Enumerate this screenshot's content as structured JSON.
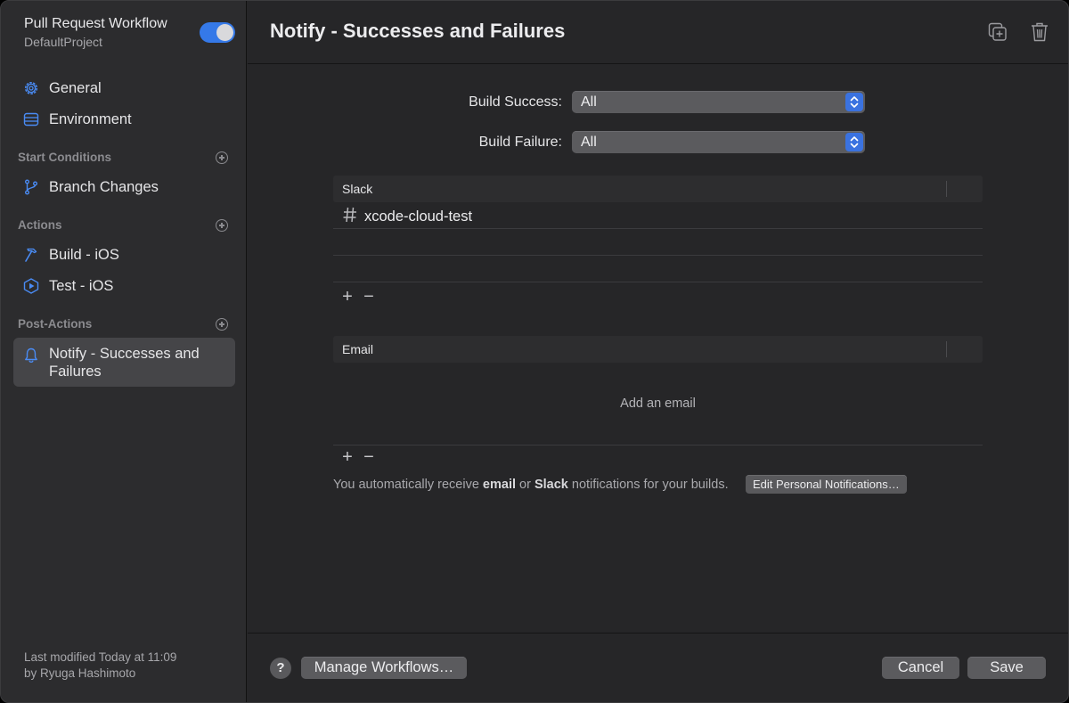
{
  "sidebar": {
    "workflow_title": "Pull Request Workflow",
    "project_name": "DefaultProject",
    "enabled": true,
    "general_label": "General",
    "environment_label": "Environment",
    "sections": {
      "start_conditions": "Start Conditions",
      "actions": "Actions",
      "post_actions": "Post-Actions"
    },
    "branch_changes_label": "Branch Changes",
    "build_label": "Build - iOS",
    "test_label": "Test - iOS",
    "notify_label_line1": "Notify - Successes and",
    "notify_label_line2": "Failures",
    "footer_line1": "Last modified Today at 11:09",
    "footer_line2": "by Ryuga Hashimoto"
  },
  "main": {
    "title": "Notify - Successes and Failures",
    "build_success_label": "Build Success:",
    "build_success_value": "All",
    "build_failure_label": "Build Failure:",
    "build_failure_value": "All",
    "slack": {
      "header": "Slack",
      "channels": [
        "xcode-cloud-test"
      ]
    },
    "email": {
      "header": "Email",
      "empty_text": "Add an email"
    },
    "plus": "+",
    "minus": "−",
    "note_prefix": "You automatically receive ",
    "note_email": "email",
    "note_or": " or ",
    "note_slack": "Slack",
    "note_suffix": " notifications for your builds.",
    "edit_personal_label": "Edit Personal Notifications…"
  },
  "footer": {
    "help_label": "?",
    "manage_label": "Manage Workflows…",
    "cancel_label": "Cancel",
    "save_label": "Save"
  },
  "colors": {
    "accent": "#3579e8",
    "sidebar_icon": "#4a8cf5",
    "selected_row": "#454548"
  },
  "icons": {
    "header": [
      "duplicate-icon",
      "trash-icon"
    ],
    "sidebar": [
      "gear-icon",
      "environment-icon",
      "branch-icon",
      "hammer-icon",
      "test-play-icon",
      "bell-icon"
    ]
  }
}
